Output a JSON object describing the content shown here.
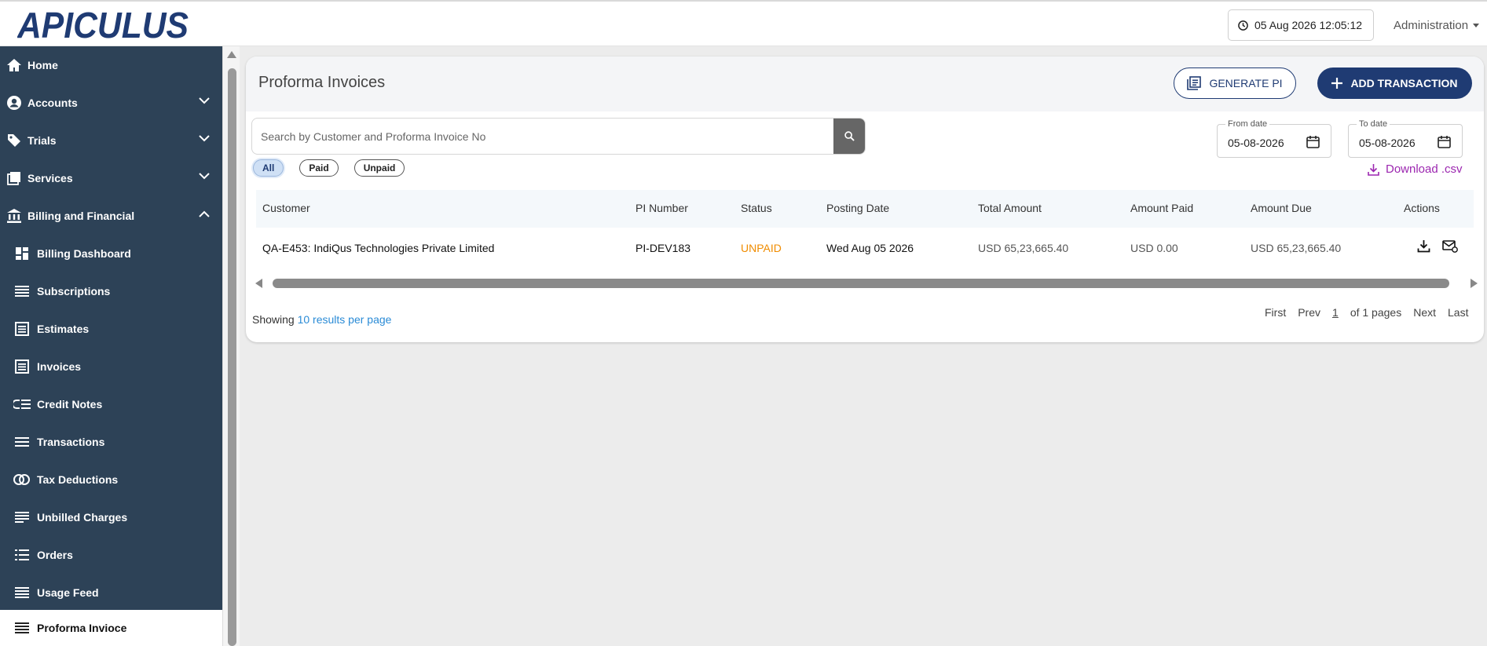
{
  "brand": {
    "logo_text": "APICULUS",
    "color": "#1f3b73"
  },
  "header": {
    "datetime": "05 Aug 2026 12:05:12",
    "user_menu": "Administration"
  },
  "sidebar": {
    "items": [
      {
        "label": "Home",
        "icon": "home-icon"
      },
      {
        "label": "Accounts",
        "icon": "account-icon",
        "expandable": true
      },
      {
        "label": "Trials",
        "icon": "tag-icon",
        "expandable": true
      },
      {
        "label": "Services",
        "icon": "services-icon",
        "expandable": true
      },
      {
        "label": "Billing and Financial",
        "icon": "bank-icon",
        "expanded": true
      },
      {
        "label": "Billing Dashboard",
        "icon": "dashboard-icon"
      },
      {
        "label": "Subscriptions",
        "icon": "list-icon"
      },
      {
        "label": "Estimates",
        "icon": "document-icon"
      },
      {
        "label": "Invoices",
        "icon": "document-icon"
      },
      {
        "label": "Credit Notes",
        "icon": "credit-note-icon"
      },
      {
        "label": "Transactions",
        "icon": "lines-icon"
      },
      {
        "label": "Tax Deductions",
        "icon": "tax-icon"
      },
      {
        "label": "Unbilled Charges",
        "icon": "notes-icon"
      },
      {
        "label": "Orders",
        "icon": "orders-icon"
      },
      {
        "label": "Usage Feed",
        "icon": "feed-icon"
      },
      {
        "label": "Proforma Invioce",
        "icon": "list-icon",
        "active": true
      }
    ]
  },
  "main": {
    "title": "Proforma Invoices",
    "generate_label": "GENERATE PI",
    "add_label": "ADD TRANSACTION",
    "search": {
      "placeholder": "Search by Customer and Proforma Invoice No",
      "value": ""
    },
    "filters": [
      {
        "label": "All",
        "active": true
      },
      {
        "label": "Paid",
        "active": false
      },
      {
        "label": "Unpaid",
        "active": false
      }
    ],
    "from_date": {
      "label": "From date",
      "value": "05-08-2026"
    },
    "to_date": {
      "label": "To date",
      "value": "05-08-2026"
    },
    "download_label": "Download .csv",
    "table": {
      "columns": [
        "Customer",
        "PI Number",
        "Status",
        "Posting Date",
        "Total Amount",
        "Amount Paid",
        "Amount Due",
        "Actions"
      ],
      "rows": [
        {
          "customer": "QA-E453: IndiQus Technologies Private Limited",
          "pi_number": "PI-DEV183",
          "status": "UNPAID",
          "posting_date": "Wed Aug 05 2026",
          "total_amount": "USD 65,23,665.40",
          "amount_paid": "USD 0.00",
          "amount_due": "USD 65,23,665.40"
        }
      ]
    },
    "footer": {
      "showing": "Showing",
      "per_page": "10 results per page",
      "first": "First",
      "prev": "Prev",
      "page": "1",
      "of_pages": "of 1 pages",
      "next": "Next",
      "last": "Last"
    }
  },
  "colors": {
    "sidebar": "#2d4257",
    "primary": "#1f3b73",
    "unpaid": "#f08c00",
    "download": "#9c27b0",
    "link": "#2a8bd6"
  }
}
